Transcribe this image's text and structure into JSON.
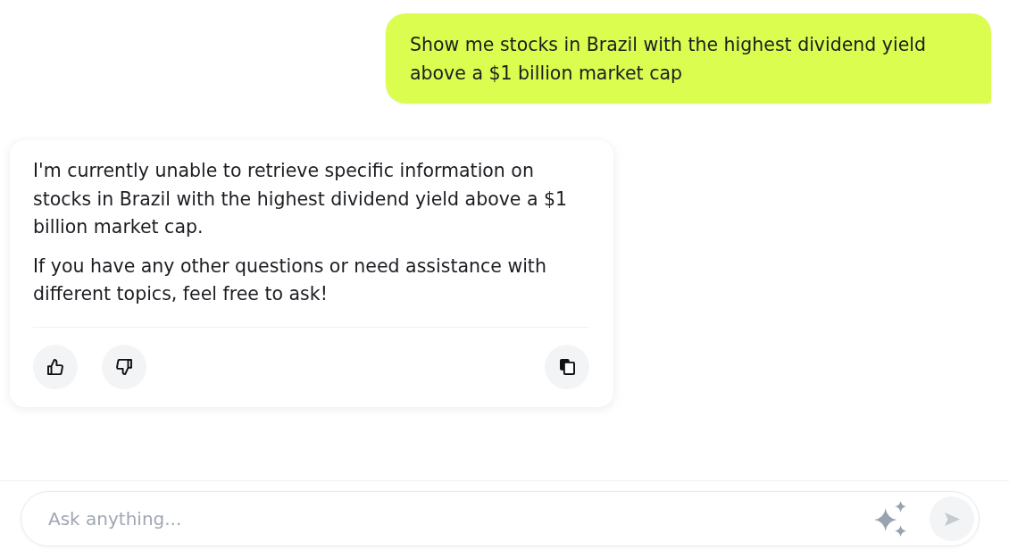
{
  "conversation": {
    "messages": [
      {
        "kind": "user",
        "paragraphs": [
          "Show me stocks in Brazil with the highest dividend yield above a $1 billion market cap"
        ]
      },
      {
        "kind": "assistant",
        "paragraphs": [
          "I'm currently unable to retrieve specific information on stocks in Brazil with the highest dividend yield above a $1 billion market cap.",
          "If you have any other questions or need assistance with different topics, feel free to ask!"
        ]
      }
    ]
  },
  "composer": {
    "placeholder": "Ask anything...",
    "send_button": {
      "disabled": true
    }
  }
}
